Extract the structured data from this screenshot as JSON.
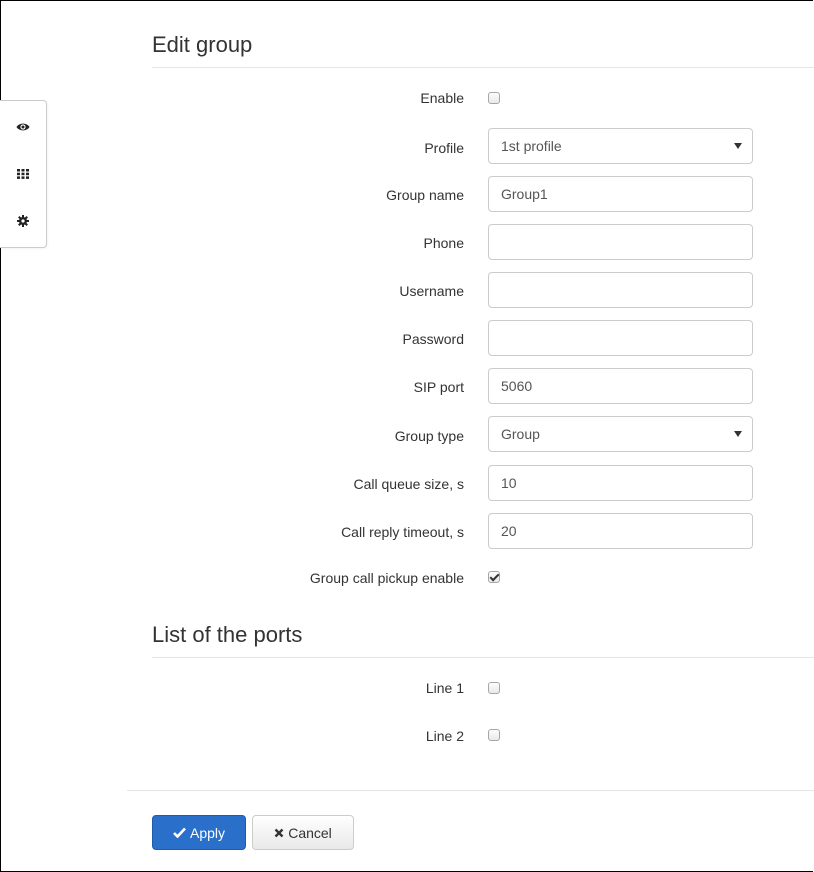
{
  "edit_group": {
    "title": "Edit group",
    "enable": {
      "label": "Enable",
      "checked": false
    },
    "profile": {
      "label": "Profile",
      "value": "1st profile"
    },
    "group_name": {
      "label": "Group name",
      "value": "Group1"
    },
    "phone": {
      "label": "Phone",
      "value": ""
    },
    "username": {
      "label": "Username",
      "value": ""
    },
    "password": {
      "label": "Password",
      "value": ""
    },
    "sip_port": {
      "label": "SIP port",
      "value": "5060"
    },
    "group_type": {
      "label": "Group type",
      "value": "Group"
    },
    "call_queue_size": {
      "label": "Call queue size, s",
      "value": "10"
    },
    "call_reply_timeout": {
      "label": "Call reply timeout, s",
      "value": "20"
    },
    "group_call_pickup": {
      "label": "Group call pickup enable",
      "checked": true
    }
  },
  "ports": {
    "title": "List of the ports",
    "lines": [
      {
        "label": "Line 1",
        "checked": false
      },
      {
        "label": "Line 2",
        "checked": false
      }
    ]
  },
  "actions": {
    "apply_label": "Apply",
    "cancel_label": "Cancel"
  },
  "side_toolbar": {
    "icons": [
      "eye-icon",
      "grid-icon",
      "gear-icon"
    ]
  },
  "colors": {
    "primary": "#2a6fc9",
    "border": "#cccccc"
  }
}
